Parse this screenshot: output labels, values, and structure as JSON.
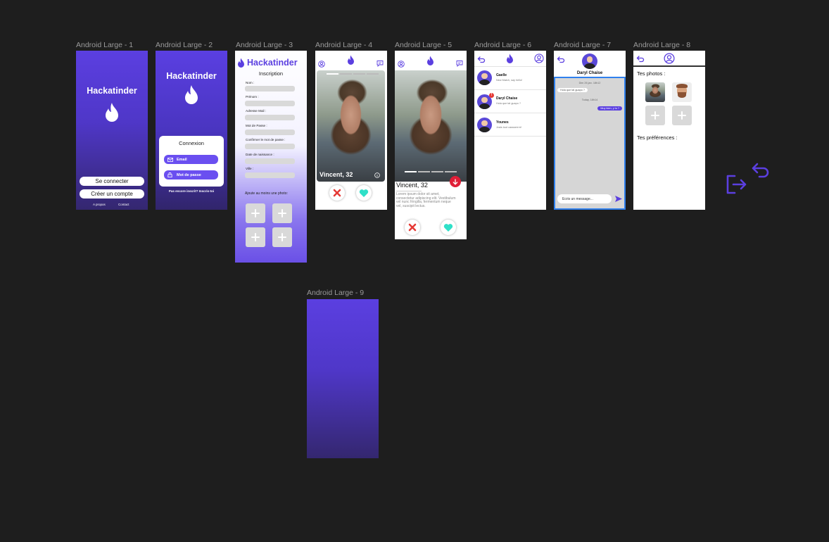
{
  "colors": {
    "canvas": "#1e1e1e",
    "accent": "#6a4ff0",
    "like": "#2fe0c8",
    "dislike": "#e53935"
  },
  "frames": {
    "f1": {
      "label": "Android Large - 1",
      "title": "Hackatinder",
      "btn_login": "Se connecter",
      "btn_signup": "Créer un compte",
      "link_about": "A propos",
      "link_contact": "Contact"
    },
    "f2": {
      "label": "Android Large - 2",
      "title": "Hackatinder",
      "card_title": "Connexion",
      "email": "Email",
      "password": "Mot de passe",
      "footer": "Pas encore inscrit? Inscris-toi"
    },
    "f3": {
      "label": "Android Large - 3",
      "title": "Hackatinder",
      "subtitle": "Inscription",
      "fields": [
        "Nom :",
        "Prénom :",
        "Adresse Mail :",
        "Mot de Passe :",
        "Confirmer le mot de passe :",
        "Date de naissance :",
        "Ville :"
      ],
      "photo_prompt": "Ajoute au moins une photo:"
    },
    "f4": {
      "label": "Android Large - 4",
      "caption": "Vincent, 32"
    },
    "f5": {
      "label": "Android Large - 5",
      "caption": "Vincent, 32",
      "bio": "Lorem ipsum dolor sit amet, consectetur adipiscing elit. Vestibulum vel nunc fringilla, fermentum neque vel, suscipit lectus."
    },
    "f6": {
      "label": "Android Large - 6",
      "chats": [
        {
          "name": "Gaelle",
          "msg": "New Match, say hello!"
        },
        {
          "name": "Daryl Chaise",
          "msg": "Hola que tal guapo ?"
        },
        {
          "name": "Younes",
          "msg": "Jvais tout cassserrrrr!"
        }
      ]
    },
    "f7": {
      "label": "Android Large - 7",
      "name": "Daryl Chaise",
      "date1": "Dim 26 jan. 18h12",
      "msg_in": "Hola que tal guapo ?",
      "date2": "Today, 18h14",
      "msg_out": "Muy bien, y tu ?",
      "input_placeholder": "Ecris un message..."
    },
    "f8": {
      "label": "Android Large - 8",
      "photos_title": "Tes photos :",
      "prefs_title": "Tes préférences :"
    },
    "f9": {
      "label": "Android Large - 9"
    }
  },
  "icons": [
    "logout-icon",
    "undo-icon"
  ]
}
